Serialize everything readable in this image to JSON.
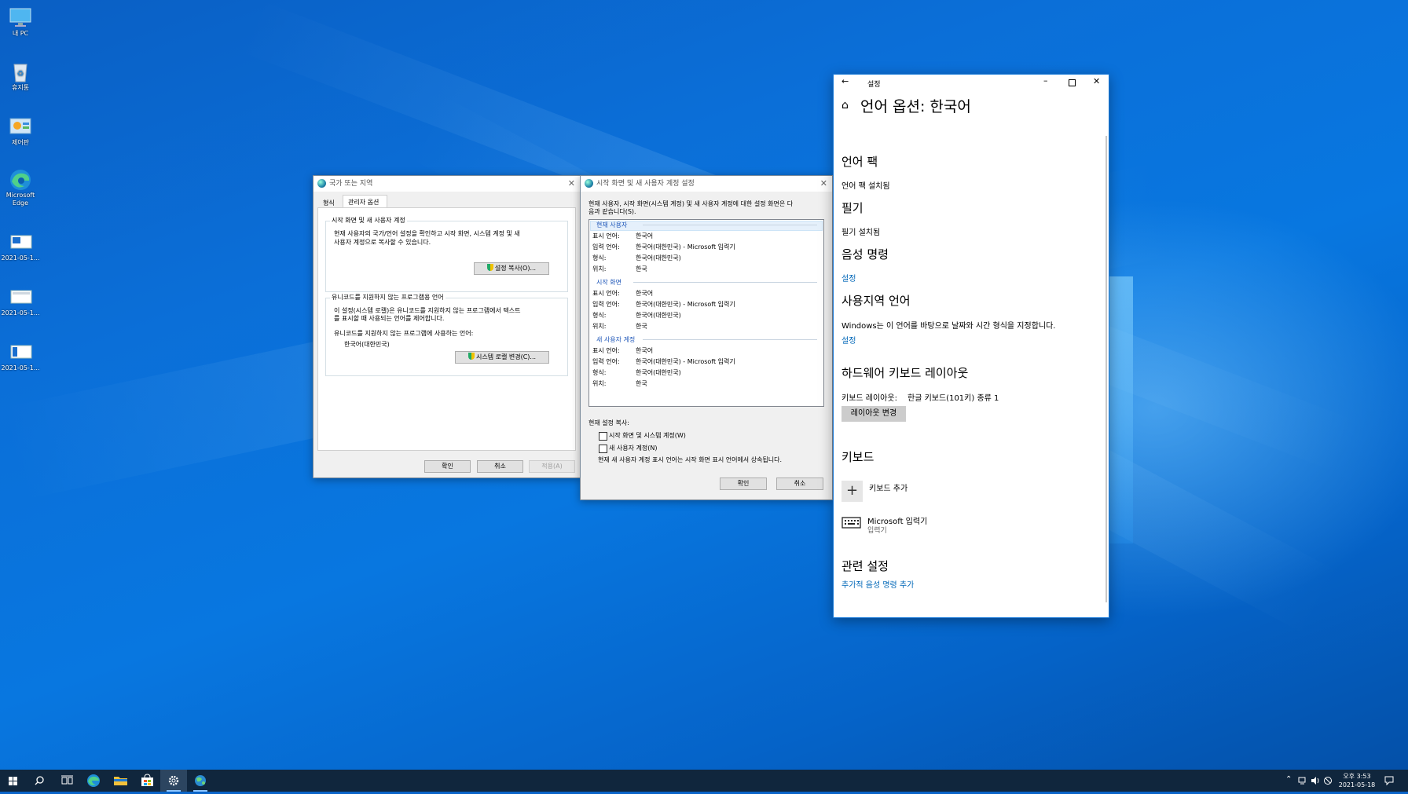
{
  "desktop": {
    "icons": [
      {
        "label": "내 PC",
        "icon": "this-pc-icon"
      },
      {
        "label": "휴지통",
        "icon": "recycle-bin-icon"
      },
      {
        "label": "제어판",
        "icon": "control-panel-icon"
      },
      {
        "label": "Microsoft Edge",
        "icon": "edge-icon"
      },
      {
        "label": "2021-05-1...",
        "icon": "screenshot-file-icon"
      },
      {
        "label": "2021-05-1...",
        "icon": "screenshot-file-icon"
      },
      {
        "label": "2021-05-1...",
        "icon": "screenshot-file-icon"
      }
    ]
  },
  "region_dialog": {
    "title": "국가 또는 지역",
    "tabs": [
      "형식",
      "관리자 옵션"
    ],
    "welcome_group": {
      "legend": "시작 화면 및 새 사용자 계정",
      "desc_line1": "현재 사용자의 국가/언어 설정을 확인하고 시작 화면, 시스템 계정 및 새",
      "desc_line2": "사용자 계정으로 복사할 수 있습니다.",
      "button": "설정 복사(O)..."
    },
    "unicode_group": {
      "legend": "유니코드를 지원하지 않는 프로그램용 언어",
      "desc_line1": "이 설정(시스템 로캘)은 유니코드를 지원하지 않는 프로그램에서 텍스트",
      "desc_line2": "를 표시할 때 사용되는 언어를 제어합니다.",
      "current_label": "유니코드를 지원하지 않는 프로그램에 사용하는 언어:",
      "current_value": "한국어(대한민국)",
      "button": "시스템 로캘 변경(C)..."
    },
    "buttons": {
      "ok": "확인",
      "cancel": "취소",
      "apply": "적용(A)"
    }
  },
  "welcome_dialog": {
    "title": "시작 화면 및 새 사용자 계정 설정",
    "intro_line1": "현재 사용자, 시작 화면(시스템 계정) 및 새 사용자 계정에 대한 설정 화면은 다",
    "intro_line2": "음과 같습니다(S).",
    "sections": [
      {
        "header": "현재 사용자",
        "rows": [
          {
            "label": "표시 언어:",
            "value": "한국어"
          },
          {
            "label": "입력 언어:",
            "value": "한국어(대한민국) - Microsoft 입력기"
          },
          {
            "label": "형식:",
            "value": "한국어(대한민국)"
          },
          {
            "label": "위치:",
            "value": "한국"
          }
        ]
      },
      {
        "header": "시작 화면",
        "rows": [
          {
            "label": "표시 언어:",
            "value": "한국어"
          },
          {
            "label": "입력 언어:",
            "value": "한국어(대한민국) - Microsoft 입력기"
          },
          {
            "label": "형식:",
            "value": "한국어(대한민국)"
          },
          {
            "label": "위치:",
            "value": "한국"
          }
        ]
      },
      {
        "header": "새 사용자 계정",
        "rows": [
          {
            "label": "표시 언어:",
            "value": "한국어"
          },
          {
            "label": "입력 언어:",
            "value": "한국어(대한민국) - Microsoft 입력기"
          },
          {
            "label": "형식:",
            "value": "한국어(대한민국)"
          },
          {
            "label": "위치:",
            "value": "한국"
          }
        ]
      }
    ],
    "copy_label": "현재 설정 복사:",
    "check_welcome": "시작 화면 및 시스템 계정(W)",
    "check_newuser": "새 사용자 계정(N)",
    "note": "현재 새 사용자 계정 표시 언어는 시작 화면 표시 언어에서 상속됩니다.",
    "buttons": {
      "ok": "확인",
      "cancel": "취소"
    }
  },
  "settings": {
    "titlebar": "설정",
    "page_title": "언어 옵션: 한국어",
    "language_pack": {
      "heading": "언어 팩",
      "status": "언어 팩 설치됨"
    },
    "handwriting": {
      "heading": "필기",
      "status": "필기 설치됨"
    },
    "speech": {
      "heading": "음성 명령",
      "link": "설정"
    },
    "regional": {
      "heading": "사용지역 언어",
      "desc": "Windows는 이 언어를 바탕으로 날짜와 시간 형식을 지정합니다.",
      "link": "설정"
    },
    "hw_keyboard": {
      "heading": "하드웨어 키보드 레이아웃",
      "layout_label": "키보드 레이아웃:",
      "layout_value": "한글 키보드(101키) 종류 1",
      "button": "레이아웃 변경"
    },
    "keyboards": {
      "heading": "키보드",
      "add_label": "키보드 추가",
      "ime_name": "Microsoft 입력기",
      "ime_sub": "입력기"
    },
    "related": {
      "heading": "관련 설정",
      "link": "추가적 음성 명령 추가"
    }
  },
  "taskbar": {
    "clock_time": "오후 3:53",
    "clock_date": "2021-05-18"
  }
}
